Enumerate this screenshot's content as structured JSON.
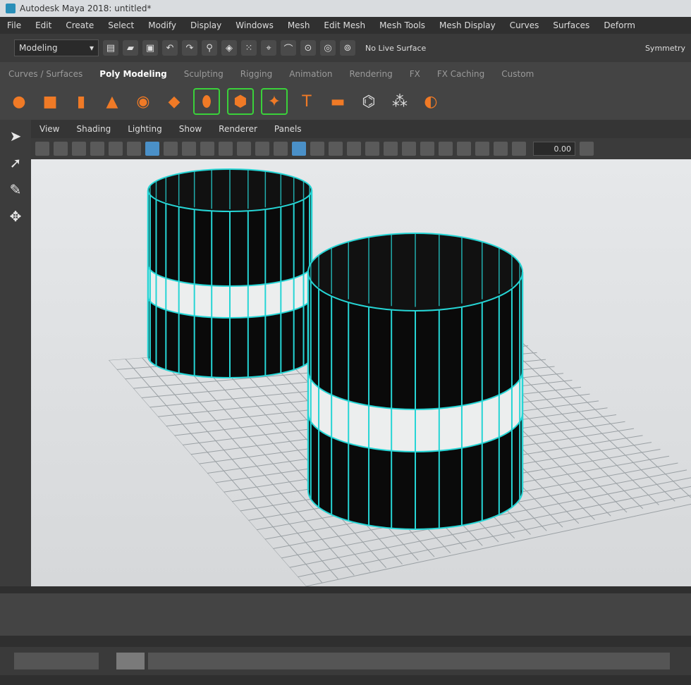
{
  "window": {
    "title": "Autodesk Maya 2018: untitled*"
  },
  "menus": [
    "File",
    "Edit",
    "Create",
    "Select",
    "Modify",
    "Display",
    "Windows",
    "Mesh",
    "Edit Mesh",
    "Mesh Tools",
    "Mesh Display",
    "Curves",
    "Surfaces",
    "Deform"
  ],
  "statusline": {
    "mode": "Modeling",
    "live_surface": "No Live Surface",
    "symmetry": "Symmetry"
  },
  "shelf_tabs": [
    {
      "label": "Curves / Surfaces",
      "active": false
    },
    {
      "label": "Poly Modeling",
      "active": true
    },
    {
      "label": "Sculpting",
      "active": false
    },
    {
      "label": "Rigging",
      "active": false
    },
    {
      "label": "Animation",
      "active": false
    },
    {
      "label": "Rendering",
      "active": false
    },
    {
      "label": "FX",
      "active": false
    },
    {
      "label": "FX Caching",
      "active": false
    },
    {
      "label": "Custom",
      "active": false
    }
  ],
  "shelf_icons": [
    "sphere-icon",
    "cube-icon",
    "cylinder-icon",
    "cone-icon",
    "torus-icon",
    "plane-icon",
    "combine-icon",
    "separate-icon",
    "bevel-icon",
    "type-icon",
    "svg-icon"
  ],
  "panel_menu": [
    "View",
    "Shading",
    "Lighting",
    "Show",
    "Renderer",
    "Panels"
  ],
  "panel_toolbar": {
    "field_value": "0.00"
  },
  "colors": {
    "wire": "#26d5d5",
    "shelf_orange": "#f07a26",
    "bracket_green": "#3ad13a",
    "viewport_bg": "#e2e4e6",
    "ui_dark": "#2b2b2b"
  }
}
